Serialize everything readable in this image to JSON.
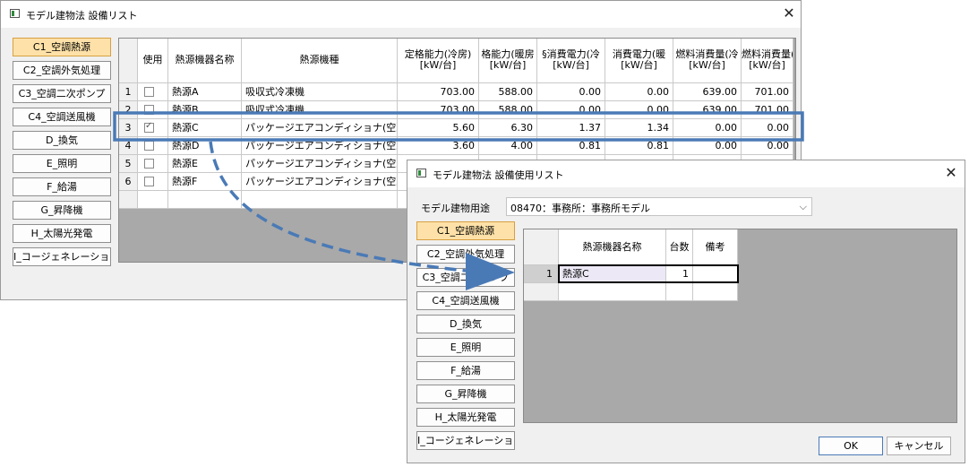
{
  "main_window": {
    "title": "モデル建物法 設備リスト",
    "categories": [
      "C1_空調熱源",
      "C2_空調外気処理",
      "C3_空調二次ポンプ",
      "C4_空調送風機",
      "D_換気",
      "E_照明",
      "F_給湯",
      "G_昇降機",
      "H_太陽光発電",
      "I_コージェネレーション"
    ],
    "selected_category": "C1_空調熱源",
    "columns": [
      "使用",
      "熱源機器名称",
      "熱源機種",
      "定格能力(冷房)\n[kW/台]",
      "格能力(暖房\n[kW/台]",
      "§消費電力(冷\n[kW/台]",
      "消費電力(暖\n[kW/台]",
      "燃料消費量(冷\n[kW/台]",
      "燃料消費量(\n[kW/台]"
    ],
    "rows": [
      {
        "no": "1",
        "checked": false,
        "name": "熱源A",
        "type": "吸収式冷凍機",
        "v": [
          "703.00",
          "588.00",
          "0.00",
          "0.00",
          "639.00",
          "701.00"
        ]
      },
      {
        "no": "2",
        "checked": false,
        "name": "熱源B",
        "type": "吸収式冷凍機",
        "v": [
          "703.00",
          "588.00",
          "0.00",
          "0.00",
          "639.00",
          "701.00"
        ]
      },
      {
        "no": "3",
        "checked": true,
        "name": "熱源C",
        "type": "パッケージエアコンディショナ(空冷式)",
        "v": [
          "5.60",
          "6.30",
          "1.37",
          "1.34",
          "0.00",
          "0.00"
        ]
      },
      {
        "no": "4",
        "checked": false,
        "name": "熱源D",
        "type": "パッケージエアコンディショナ(空冷式)",
        "v": [
          "3.60",
          "4.00",
          "0.81",
          "0.81",
          "0.00",
          "0.00"
        ]
      },
      {
        "no": "5",
        "checked": false,
        "name": "熱源E",
        "type": "パッケージエアコンディショナ(空冷式)",
        "v": [
          "",
          "",
          "",
          "",
          "",
          ""
        ]
      },
      {
        "no": "6",
        "checked": false,
        "name": "熱源F",
        "type": "パッケージエアコンディショナ(空冷式)",
        "v": [
          "",
          "",
          "",
          "",
          "",
          ""
        ]
      }
    ]
  },
  "usage_window": {
    "title": "モデル建物法 設備使用リスト",
    "building_use_label": "モデル建物用途",
    "building_use_value": "08470：事務所：事務所モデル",
    "categories": [
      "C1_空調熱源",
      "C2_空調外気処理",
      "C3_空調二次ポンプ",
      "C4_空調送風機",
      "D_換気",
      "E_照明",
      "F_給湯",
      "G_昇降機",
      "H_太陽光発電",
      "I_コージェネレーション"
    ],
    "selected_category": "C1_空調熱源",
    "columns": [
      "熱源機器名称",
      "台数",
      "備考"
    ],
    "rows": [
      {
        "no": "1",
        "name": "熱源C",
        "count": "1",
        "note": ""
      }
    ],
    "ok_label": "OK",
    "cancel_label": "キャンセル"
  },
  "annotation": {
    "highlight_color": "#4a7ab6",
    "arrow_color": "#4a7ab6"
  },
  "icons": {
    "close": "close-icon",
    "window": "window-icon",
    "dropdown": "chevron-down-icon",
    "checkmark": "check-icon"
  }
}
